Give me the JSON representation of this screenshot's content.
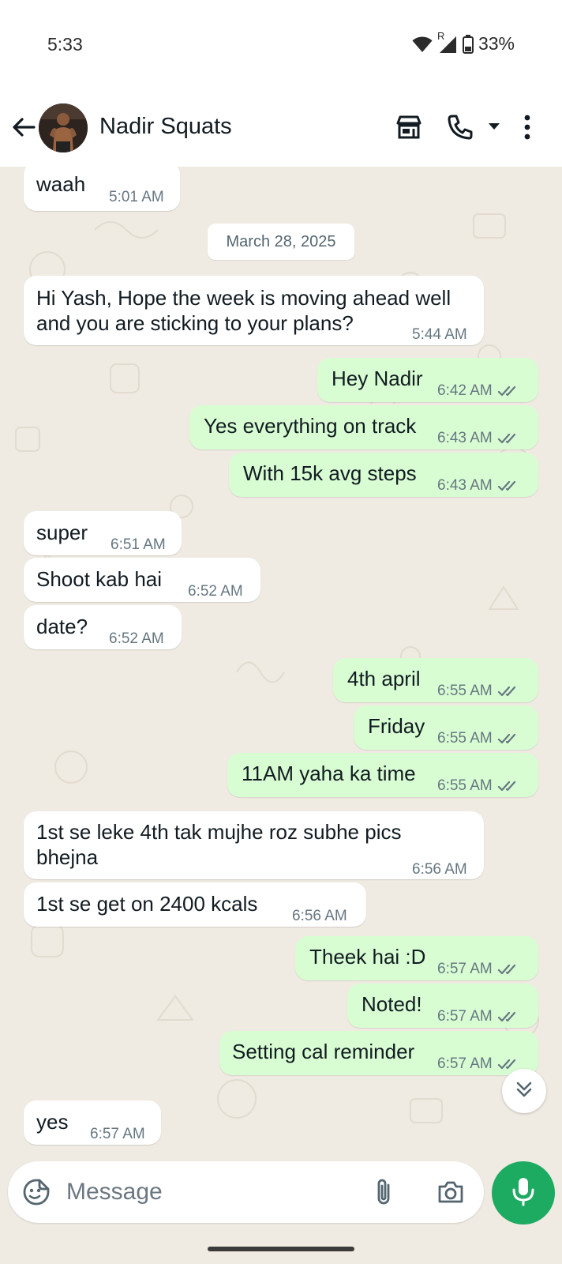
{
  "status_bar": {
    "time": "5:33",
    "battery": "33%",
    "roaming": "R"
  },
  "header": {
    "contact_name": "Nadir Squats"
  },
  "date_chip": "March 28, 2025",
  "messages": [
    {
      "dir": "in",
      "text": "waah",
      "time": "5:01 AM"
    },
    {
      "dir": "in",
      "text_lines": [
        "Hi Yash, Hope the week is moving ahead well",
        "and you are sticking to your plans?"
      ],
      "time": "5:44 AM"
    },
    {
      "dir": "out",
      "text": "Hey Nadir",
      "time": "6:42 AM"
    },
    {
      "dir": "out",
      "text": "Yes everything on track",
      "time": "6:43 AM"
    },
    {
      "dir": "out",
      "text": "With 15k avg steps",
      "time": "6:43 AM"
    },
    {
      "dir": "in",
      "text": "super",
      "time": "6:51 AM"
    },
    {
      "dir": "in",
      "text": "Shoot kab hai",
      "time": "6:52 AM"
    },
    {
      "dir": "in",
      "text": "date?",
      "time": "6:52 AM"
    },
    {
      "dir": "out",
      "text": "4th april",
      "time": "6:55 AM"
    },
    {
      "dir": "out",
      "text": "Friday",
      "time": "6:55 AM"
    },
    {
      "dir": "out",
      "text": "11AM yaha ka time",
      "time": "6:55 AM"
    },
    {
      "dir": "in",
      "text_lines": [
        "1st se leke 4th tak mujhe roz subhe pics",
        "bhejna"
      ],
      "time": "6:56 AM"
    },
    {
      "dir": "in",
      "text": "1st se get on 2400 kcals",
      "time": "6:56 AM"
    },
    {
      "dir": "out",
      "text": "Theek hai :D",
      "time": "6:57 AM"
    },
    {
      "dir": "out",
      "text": "Noted!",
      "time": "6:57 AM"
    },
    {
      "dir": "out",
      "text": "Setting cal reminder",
      "time": "6:57 AM"
    },
    {
      "dir": "in",
      "text": "yes",
      "time": "6:57 AM"
    }
  ],
  "input": {
    "placeholder": "Message"
  },
  "colors": {
    "accent": "#1daa61",
    "outgoing_bubble": "#d9fdd3",
    "incoming_bubble": "#ffffff",
    "chat_bg": "#efeae2",
    "read_ticks": "#667781"
  },
  "icons": {
    "header": [
      "back-arrow-icon",
      "catalog-store-icon",
      "phone-icon",
      "dropdown-caret-icon",
      "more-vert-icon"
    ],
    "input": [
      "sticker-icon",
      "attach-paperclip-icon",
      "camera-icon",
      "mic-icon"
    ],
    "status": [
      "wifi-icon",
      "cellular-signal-icon",
      "battery-icon"
    ],
    "chat": [
      "double-chevron-down-icon"
    ]
  }
}
